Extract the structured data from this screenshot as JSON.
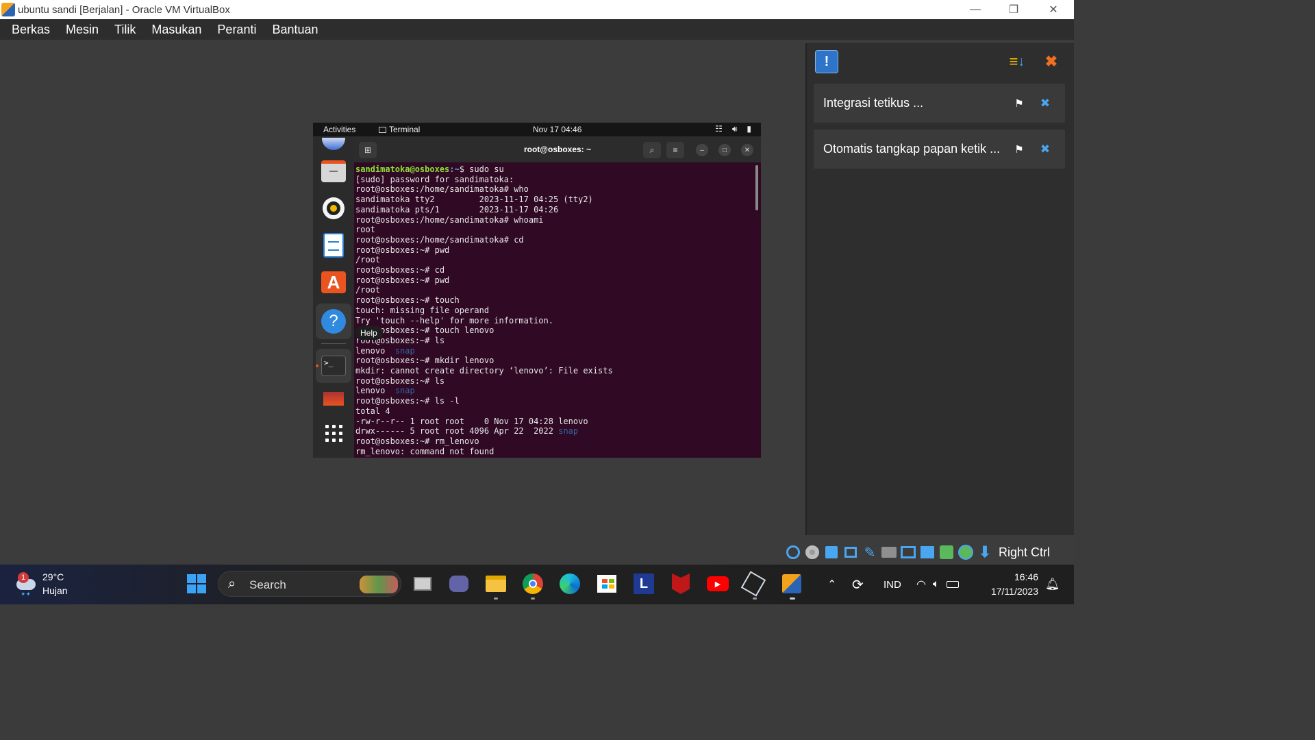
{
  "window": {
    "title": "ubuntu sandi [Berjalan] - Oracle VM VirtualBox",
    "minimize": "—",
    "restore": "❐",
    "close": "✕"
  },
  "menu": [
    "Berkas",
    "Mesin",
    "Tilik",
    "Masukan",
    "Peranti",
    "Bantuan"
  ],
  "guest": {
    "topbar": {
      "activities": "Activities",
      "app": "Terminal",
      "clock": "Nov 17  04:46"
    },
    "terminal": {
      "title": "root@osboxes: ~",
      "tooltip": "Help",
      "lines": [
        {
          "u": "sandimatoka@osboxes",
          "p": ":~",
          "t": "$ sudo su"
        },
        {
          "t": "[sudo] password for sandimatoka:"
        },
        {
          "t": "root@osboxes:/home/sandimatoka# who"
        },
        {
          "t": "sandimatoka tty2         2023-11-17 04:25 (tty2)"
        },
        {
          "t": "sandimatoka pts/1        2023-11-17 04:26"
        },
        {
          "t": "root@osboxes:/home/sandimatoka# whoami"
        },
        {
          "t": "root"
        },
        {
          "t": "root@osboxes:/home/sandimatoka# cd"
        },
        {
          "t": "root@osboxes:~# pwd"
        },
        {
          "t": "/root"
        },
        {
          "t": "root@osboxes:~# cd"
        },
        {
          "t": "root@osboxes:~# pwd"
        },
        {
          "t": "/root"
        },
        {
          "t": "root@osboxes:~# touch"
        },
        {
          "t": "touch: missing file operand"
        },
        {
          "t": "Try 'touch --help' for more information."
        },
        {
          "t": "root@osboxes:~# touch lenovo"
        },
        {
          "t": "root@osboxes:~# ls"
        },
        {
          "t": "lenovo  ",
          "d": "snap"
        },
        {
          "t": "root@osboxes:~# mkdir lenovo"
        },
        {
          "t": "mkdir: cannot create directory ‘lenovo’: File exists"
        },
        {
          "t": "root@osboxes:~# ls"
        },
        {
          "t": "lenovo  ",
          "d": "snap"
        },
        {
          "t": "root@osboxes:~# ls -l"
        },
        {
          "t": "total 4"
        },
        {
          "t": "-rw-r--r-- 1 root root    0 Nov 17 04:28 lenovo"
        },
        {
          "t": "drwx------ 5 root root 4096 Apr 22  2022 ",
          "d": "snap"
        },
        {
          "t": "root@osboxes:~# rm_lenovo"
        },
        {
          "t": "rm_lenovo: command not found"
        }
      ]
    }
  },
  "notifications": {
    "items": [
      {
        "label": "Integrasi tetikus ..."
      },
      {
        "label": "Otomatis tangkap papan ketik ..."
      }
    ]
  },
  "statusbar": {
    "host_key": "Right Ctrl"
  },
  "taskbar": {
    "weather_temp": "29°C",
    "weather_desc": "Hujan",
    "weather_badge": "1",
    "search_label": "Search",
    "language": "IND",
    "time": "16:46",
    "date": "17/11/2023"
  },
  "colors": {
    "terminal_bg": "#300a24",
    "prompt_user": "#8ae234",
    "prompt_path": "#729fcf",
    "dir_listing": "#3465a4"
  }
}
